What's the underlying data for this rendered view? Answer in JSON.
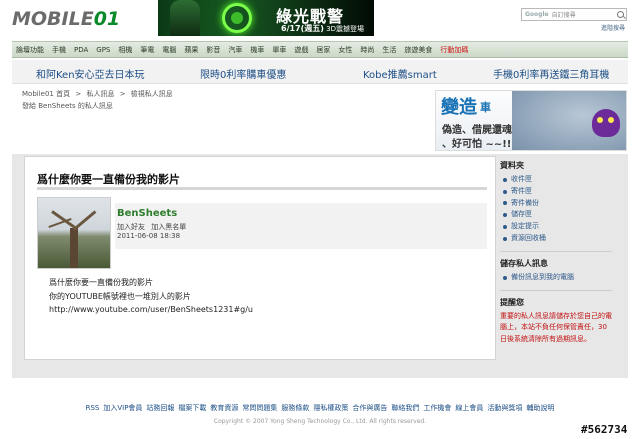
{
  "header": {
    "logo_text": "MOBILE",
    "logo_suffix": "01",
    "banner_title": "綠光戰警",
    "banner_date": "6/17(週五)",
    "banner_sub": "3D震撼登場",
    "search_brand": "Google",
    "search_placeholder": "自訂搜尋",
    "advanced_search": "進階搜尋"
  },
  "nav": {
    "items": [
      "論壇功能",
      "手機",
      "PDA",
      "GPS",
      "相機",
      "筆電",
      "電腦",
      "蘋果",
      "影音",
      "汽車",
      "機車",
      "單車",
      "遊戲",
      "居家",
      "女性",
      "時尚",
      "生活",
      "旅遊美食",
      "行動加碼"
    ]
  },
  "promo": {
    "links": [
      "和阿Ken安心亞去日本玩",
      "限時0利率購車優惠",
      "Kobe推薦smart",
      "手機0利率再送鐵三角耳機"
    ]
  },
  "breadcrumb": {
    "items": [
      "Mobile01 首頁",
      ">",
      "私人訊息",
      ">",
      "檢視私人訊息"
    ],
    "subtitle": "發給 BenSheets 的私人訊息"
  },
  "ad": {
    "word1": "變造",
    "word2": "車",
    "line1": "偽造、借屍還魂",
    "line2": "、好可怕 ~~!!"
  },
  "message": {
    "title": "爲什麼你要一直備份我的影片",
    "sender": "BenSheets",
    "actions": [
      "加入好友",
      "加入黑名單"
    ],
    "date": "2011-06-08 18:38",
    "body": [
      "爲什麼你要一直備份我的影片",
      "你的YOUTUBE帳號裡也一堆別人的影片",
      "http://www.youtube.com/user/BenSheets1231#g/u"
    ]
  },
  "sidebar": {
    "folders_heading": "資料夾",
    "folders": [
      "收件匣",
      "寄件匣",
      "寄件備份",
      "儲存匣",
      "設定提示",
      "資源回收桶"
    ],
    "save_heading": "儲存私人訊息",
    "save_items": [
      "備份訊息到我的電腦"
    ],
    "warning_heading": "提醒您",
    "warning_text": "重要的私人訊息請儲存於您自己的電腦上，本站不負任何保管責任，30日後系統清除所有過期訊息。"
  },
  "footer": {
    "links": [
      "RSS",
      "加入VIP會員",
      "站務回報",
      "檔案下載",
      "教育資源",
      "常問問題集",
      "服務條款",
      "隱私權政策",
      "合作與廣告",
      "聯絡我們",
      "工作機會",
      "線上會員",
      "活動與獎項",
      "輔助說明"
    ],
    "copyright": "Copyright © 2007 Yong Sheng Technology Co., Ltd. All rights reserved.",
    "watermark": "#562734"
  },
  "colors": {
    "nav_active": "#cc1111",
    "link": "#1d4f86",
    "sender": "#2e7d2e",
    "warning": "#c21111"
  }
}
